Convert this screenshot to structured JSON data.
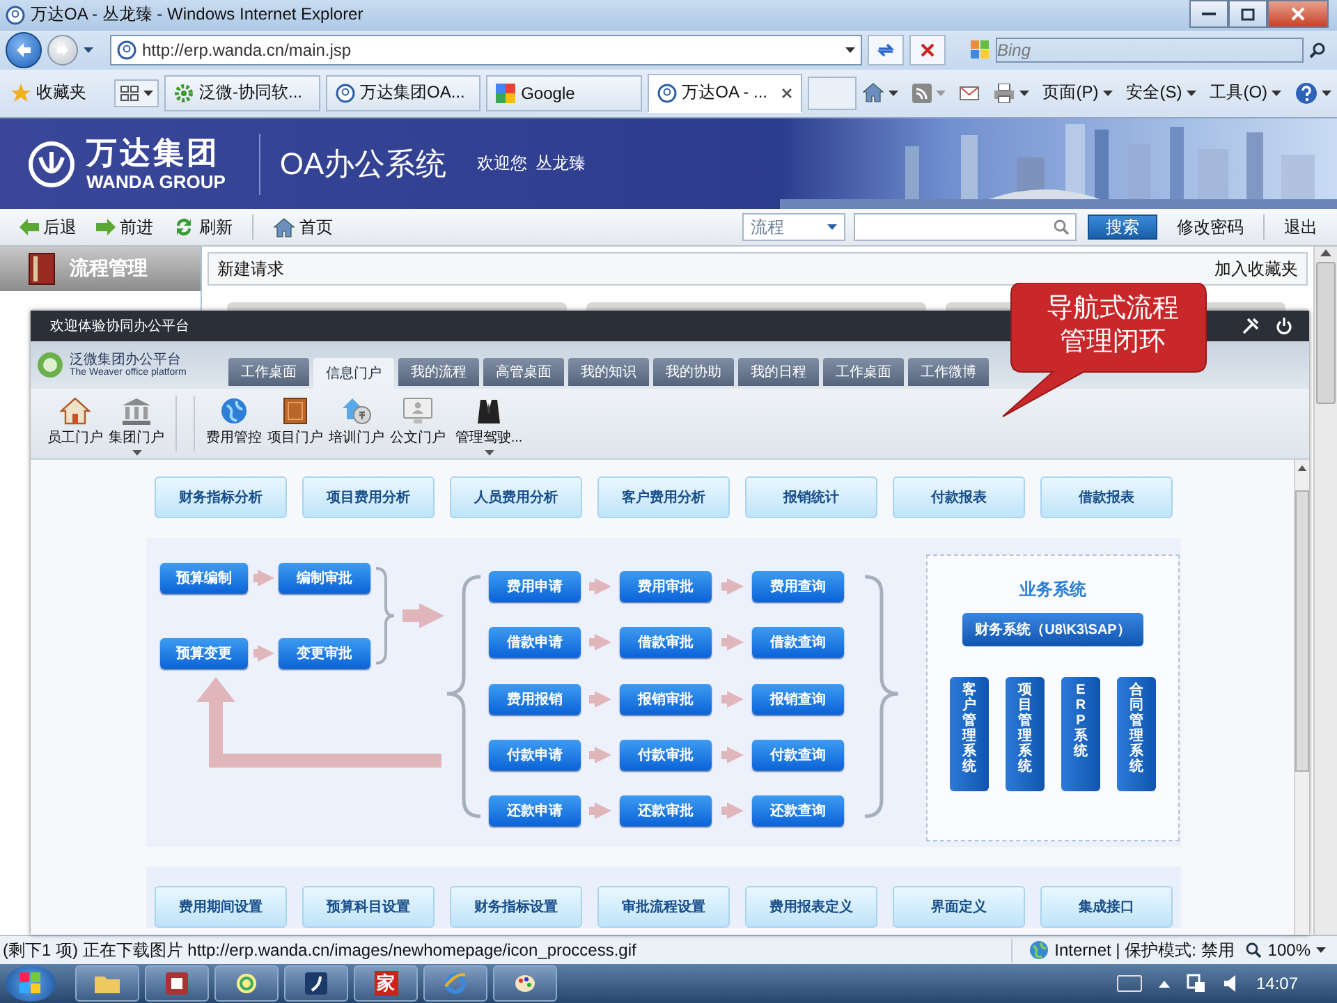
{
  "window": {
    "title": "万达OA - 丛龙臻 - Windows Internet Explorer"
  },
  "address_bar": {
    "url": "http://erp.wanda.cn/main.jsp",
    "search": {
      "placeholder": "Bing"
    }
  },
  "favorites_bar": {
    "label": "收藏夹",
    "tabs": [
      {
        "label": "泛微-协同软...",
        "kind": "gear",
        "selected": false
      },
      {
        "label": "万达集团OA...",
        "kind": "page",
        "selected": false
      },
      {
        "label": "Google",
        "kind": "google",
        "selected": false
      },
      {
        "label": "万达OA - ...",
        "kind": "page",
        "selected": true
      }
    ],
    "commands": [
      "页面(P)",
      "安全(S)",
      "工具(O)"
    ]
  },
  "header": {
    "logo_cn": "万达集团",
    "logo_en": "WANDA GROUP",
    "system_name": "OA办公系统",
    "greeting": "欢迎您",
    "user": "丛龙臻"
  },
  "nav": {
    "items": [
      {
        "label": "后退",
        "kind": "back"
      },
      {
        "label": "前进",
        "kind": "forward"
      },
      {
        "label": "刷新",
        "kind": "refresh"
      },
      {
        "label": "首页",
        "kind": "home"
      }
    ],
    "category": "流程",
    "search_button": "搜索",
    "links": [
      "修改密码",
      "退出"
    ]
  },
  "sidebar": {
    "title": "流程管理"
  },
  "main": {
    "breadcrumb": "新建请求",
    "favorite_link": "加入收藏夹"
  },
  "portal": {
    "title": "欢迎体验协同办公平台",
    "logo_name": "泛微集团办公平台",
    "logo_subtitle": "The Weaver office platform",
    "tabs": [
      {
        "label": "工作桌面",
        "selected": false
      },
      {
        "label": "信息门户",
        "selected": true
      },
      {
        "label": "我的流程",
        "selected": false
      },
      {
        "label": "高管桌面",
        "selected": false
      },
      {
        "label": "我的知识",
        "selected": false
      },
      {
        "label": "我的协助",
        "selected": false
      },
      {
        "label": "我的日程",
        "selected": false
      },
      {
        "label": "工作桌面",
        "selected": false
      },
      {
        "label": "工作微博",
        "selected": false
      }
    ],
    "toolbar": [
      {
        "label": "员工门户",
        "kind": "house",
        "has_menu": false
      },
      {
        "label": "集团门户",
        "kind": "bank",
        "has_menu": true
      },
      {
        "label": "费用管控",
        "kind": "globe",
        "has_menu": false
      },
      {
        "label": "项目门户",
        "kind": "door",
        "has_menu": false
      },
      {
        "label": "培训门户",
        "kind": "coin",
        "has_menu": false
      },
      {
        "label": "公文门户",
        "kind": "screen",
        "has_menu": false
      },
      {
        "label": "管理驾驶...",
        "kind": "suit",
        "has_menu": true
      }
    ],
    "analysis_buttons": [
      "财务指标分析",
      "项目费用分析",
      "人员费用分析",
      "客户费用分析",
      "报销统计",
      "付款报表",
      "借款报表"
    ],
    "flow": {
      "budget": [
        [
          "预算编制",
          "编制审批"
        ],
        [
          "预算变更",
          "变更审批"
        ]
      ],
      "processes": [
        [
          "费用申请",
          "费用审批",
          "费用查询"
        ],
        [
          "借款申请",
          "借款审批",
          "借款查询"
        ],
        [
          "费用报销",
          "报销审批",
          "报销查询"
        ],
        [
          "付款申请",
          "付款审批",
          "付款查询"
        ],
        [
          "还款申请",
          "还款审批",
          "还款查询"
        ]
      ],
      "systems": {
        "title": "业务系统",
        "main": "财务系统（U8\\K3\\SAP）",
        "subsystems": [
          "客户管理系统",
          "项目管理系统",
          "ERP系统",
          "合同管理系统"
        ]
      }
    },
    "settings_buttons": [
      "费用期间设置",
      "预算科目设置",
      "财务指标设置",
      "审批流程设置",
      "费用报表定义",
      "界面定义",
      "集成接口"
    ]
  },
  "callout": {
    "text": "导航式流程管理闭环"
  },
  "status_bar": {
    "message": "(剩下1 项) 正在下载图片 http://erp.wanda.cn/images/newhomepage/icon_proccess.gif",
    "zone": "Internet | 保护模式: 禁用",
    "zoom": "100%"
  },
  "taskbar": {
    "app_label": "家",
    "clock": "14:07"
  }
}
